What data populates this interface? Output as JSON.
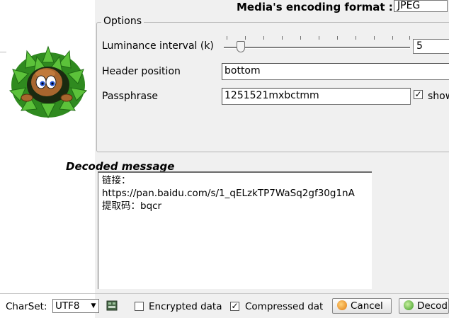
{
  "header": {
    "encoding_label": "Media's encoding format :",
    "encoding_value": "JPEG"
  },
  "options": {
    "legend": "Options",
    "luminance_label": "Luminance interval (k)",
    "luminance_value": "5",
    "header_position_label": "Header position",
    "header_position_value": "bottom",
    "passphrase_label": "Passphrase",
    "passphrase_value": "1251521mxbctmm",
    "show_label": "show",
    "show_checked": true
  },
  "decoded": {
    "title": "Decoded message",
    "lines": [
      "链接：",
      "https://pan.baidu.com/s/1_qELzkTP7WaSq2gf30g1nA",
      "提取码：bqcr"
    ]
  },
  "footer": {
    "charset_label": "CharSet:",
    "charset_value": "UTF8",
    "encrypted_label": "Encrypted data",
    "encrypted_checked": false,
    "compressed_label": "Compressed dat",
    "compressed_checked": true,
    "cancel_label": "Cancel",
    "decode_label": "Decod"
  },
  "icons": {
    "mascot": "mascot-logo",
    "charset_tool": "charset-tool-icon",
    "cancel": "cancel-icon",
    "decode": "decode-icon"
  }
}
